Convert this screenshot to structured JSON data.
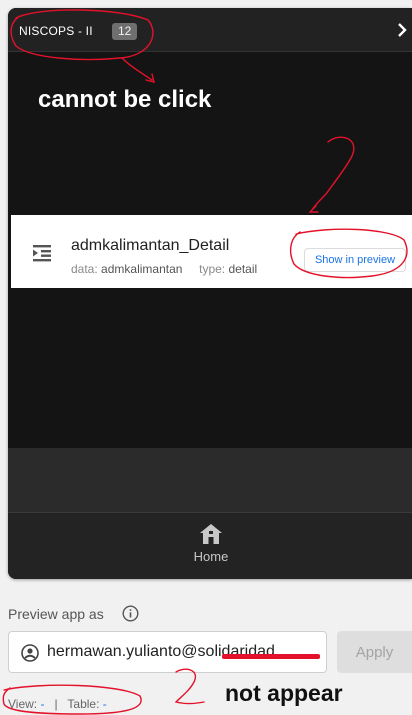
{
  "app": {
    "name": "NISCOPS - II",
    "count": "12"
  },
  "detail": {
    "title": "admkalimantan_Detail",
    "data_label": "data:",
    "data_value": "admkalimantan",
    "type_label": "type:",
    "type_value": "detail",
    "preview_button": "Show in preview"
  },
  "nav": {
    "home_label": "Home"
  },
  "preview_as": {
    "label": "Preview app as",
    "email": "hermawan.yulianto@solidaridad",
    "apply_label": "Apply",
    "view_label": "View:",
    "view_value": "-",
    "separator": "|",
    "table_label": "Table:",
    "table_value": "-"
  },
  "annotations": {
    "cannot_click": "cannot be click",
    "not_appear": "not appear",
    "ink_color": "#e3122a"
  },
  "icons": {
    "chevron": "chevron-right-icon",
    "detail": "detail-list-icon",
    "home": "home-icon",
    "info": "info-icon",
    "person": "account-circle-icon"
  }
}
